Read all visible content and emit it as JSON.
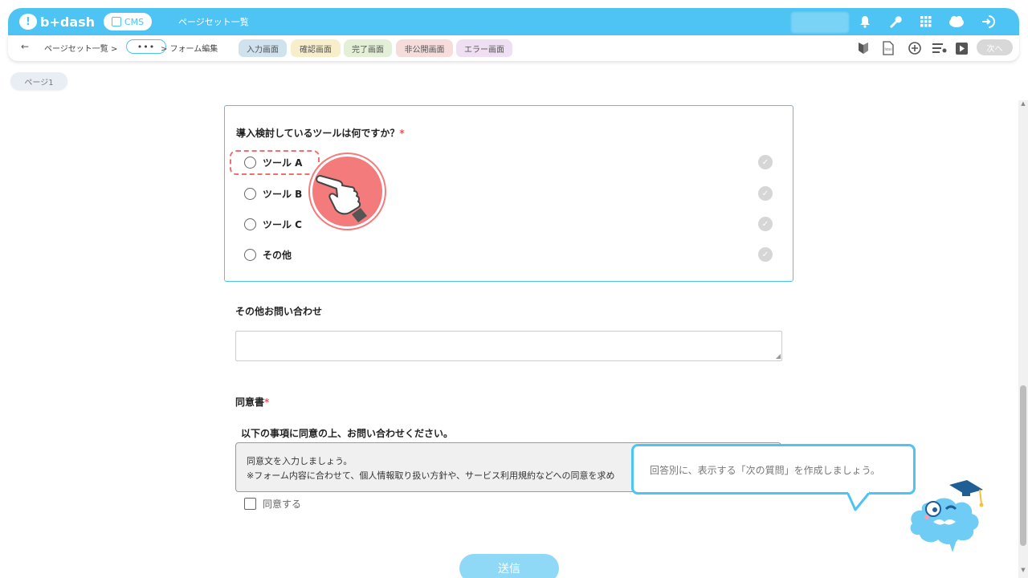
{
  "header": {
    "logo_text": "b+dash",
    "cms_label": "CMS",
    "title": "ページセット一覧",
    "icons": [
      "bell-icon",
      "wrench-icon",
      "grid-icon",
      "cloud-user-icon",
      "logout-icon"
    ]
  },
  "subbar": {
    "back_label": "←",
    "crumb_1": "ページセット一覧 >",
    "crumb_dots": "•••",
    "crumb_2": "> フォーム編集",
    "tabs": [
      {
        "label": "入力画面",
        "color": "#cfe2ee"
      },
      {
        "label": "確認画面",
        "color": "#f7efcc"
      },
      {
        "label": "完了画面",
        "color": "#e4efd8"
      },
      {
        "label": "非公開画面",
        "color": "#f7dcdc"
      },
      {
        "label": "エラー画面",
        "color": "#eee0f2"
      }
    ],
    "tool_icons": [
      "beginner-mark-icon",
      "html-file-icon",
      "add-circle-icon",
      "settings-list-icon",
      "play-icon"
    ],
    "next_label": "次へ"
  },
  "page_chip": "ページ1",
  "question": {
    "title": "導入検討しているツールは何ですか？",
    "required_mark": "*",
    "options": [
      "ツール A",
      "ツール B",
      "ツール C",
      "その他"
    ]
  },
  "other_inquiry": {
    "label": "その他お問い合わせ"
  },
  "consent": {
    "label": "同意書",
    "required_mark": "*",
    "heading": "以下の事項に同意の上、お問い合わせください。",
    "line_1": "同意文を入力しましょう。",
    "line_2": "※フォーム内容に合わせて、個人情報取り扱い方針や、サービス利用規約などへの同意を求め",
    "agree_label": "同意する"
  },
  "submit_label": "送信",
  "tip_bubble": "回答別に、表示する「次の質問」を作成しましょう。",
  "colors": {
    "brand": "#4dc4f4",
    "required": "#e85a5a",
    "pointer": "#f37b7b",
    "submit": "#8fd8f6"
  }
}
